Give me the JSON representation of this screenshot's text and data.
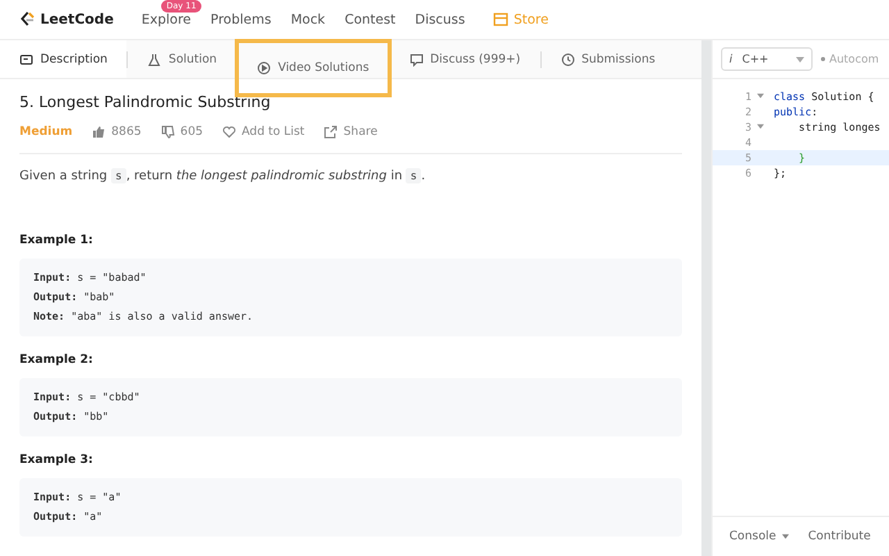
{
  "nav": {
    "logo": "LeetCode",
    "items": [
      {
        "label": "Explore",
        "badge": "Day 11"
      },
      {
        "label": "Problems"
      },
      {
        "label": "Mock"
      },
      {
        "label": "Contest"
      },
      {
        "label": "Discuss"
      }
    ],
    "store": "Store"
  },
  "tabs": [
    {
      "label": "Description",
      "selected": true,
      "highlighted": false
    },
    {
      "label": "Solution",
      "selected": false,
      "highlighted": false
    },
    {
      "label": "Video Solutions",
      "selected": false,
      "highlighted": true
    },
    {
      "label": "Discuss (999+)",
      "selected": false,
      "highlighted": false
    },
    {
      "label": "Submissions",
      "selected": false,
      "highlighted": false
    }
  ],
  "problem": {
    "title": "5. Longest Palindromic Substring",
    "difficulty": "Medium",
    "likes": "8865",
    "dislikes": "605",
    "add_to_list": "Add to List",
    "share": "Share"
  },
  "description": [
    {
      "kind": "text",
      "text": "Given a string "
    },
    {
      "kind": "code",
      "text": "s"
    },
    {
      "kind": "text",
      "text": ", return "
    },
    {
      "kind": "em",
      "text": "the longest palindromic substring"
    },
    {
      "kind": "text",
      "text": " in "
    },
    {
      "kind": "code",
      "text": "s"
    },
    {
      "kind": "text",
      "text": "."
    }
  ],
  "examples": [
    {
      "heading": "Example 1:",
      "lines": [
        {
          "label": "Input:",
          "value": "s = \"babad\""
        },
        {
          "label": "Output:",
          "value": "\"bab\""
        },
        {
          "label": "Note:",
          "value": "\"aba\" is also a valid answer."
        }
      ]
    },
    {
      "heading": "Example 2:",
      "lines": [
        {
          "label": "Input:",
          "value": "s = \"cbbd\""
        },
        {
          "label": "Output:",
          "value": "\"bb\""
        }
      ]
    },
    {
      "heading": "Example 3:",
      "lines": [
        {
          "label": "Input:",
          "value": "s = \"a\""
        },
        {
          "label": "Output:",
          "value": "\"a\""
        }
      ]
    }
  ],
  "editor": {
    "info": "i",
    "language": "C++",
    "autocomplete": "Autocom",
    "lines": [
      {
        "number": "1",
        "fold": true,
        "active": false,
        "tokens": [
          {
            "kind": "keyword",
            "text": "class"
          },
          {
            "kind": "plain",
            "text": " Solution {"
          }
        ]
      },
      {
        "number": "2",
        "fold": false,
        "active": false,
        "tokens": [
          {
            "kind": "keyword",
            "text": "public"
          },
          {
            "kind": "plain",
            "text": ":"
          }
        ]
      },
      {
        "number": "3",
        "fold": true,
        "active": false,
        "tokens": [
          {
            "kind": "plain",
            "text": "    string longes"
          }
        ]
      },
      {
        "number": "4",
        "fold": false,
        "active": false
      },
      {
        "number": "5",
        "fold": false,
        "active": true,
        "tokens": [
          {
            "kind": "bracket",
            "text": "    }"
          }
        ]
      },
      {
        "number": "6",
        "fold": false,
        "active": false,
        "tokens": [
          {
            "kind": "plain",
            "text": "};"
          }
        ]
      }
    ]
  },
  "footer": {
    "console": "Console",
    "contribute": "Contribute"
  }
}
